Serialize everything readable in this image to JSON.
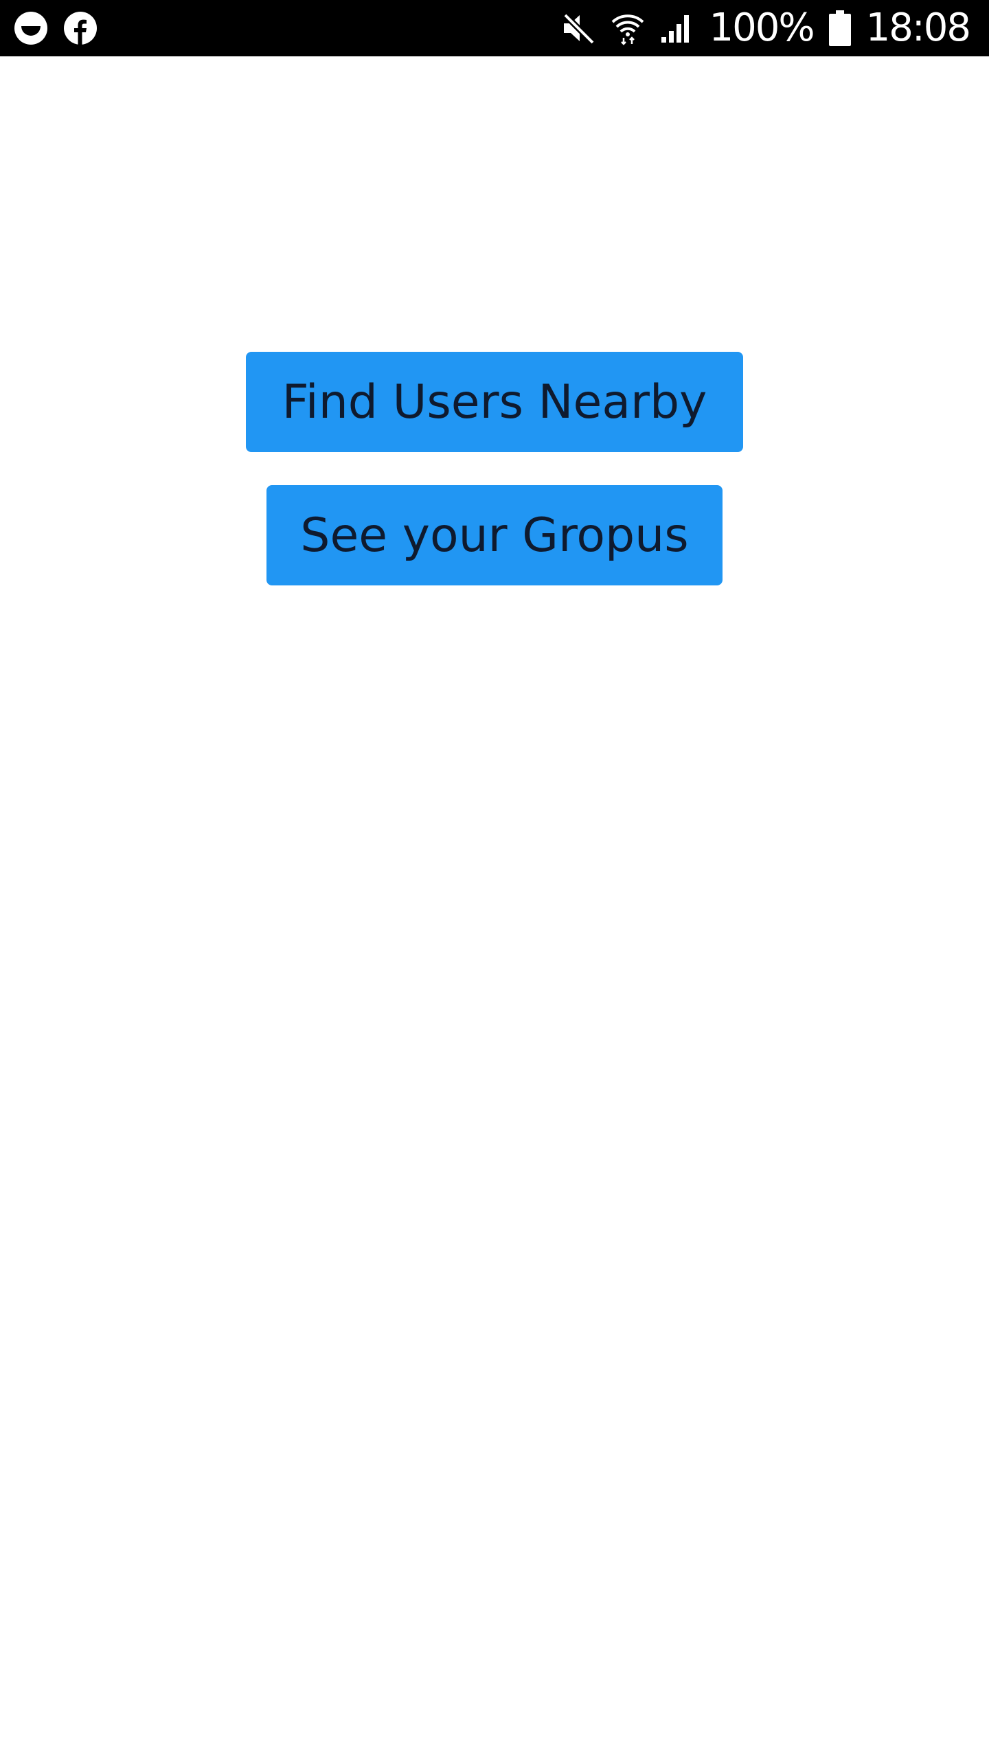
{
  "status_bar": {
    "left_icons": [
      "smiley-notification-icon",
      "facebook-icon"
    ],
    "right_icons": [
      "mute-icon",
      "wifi-icon",
      "cell-signal-icon",
      "battery-icon"
    ],
    "battery_percent": "100%",
    "time": "18:08"
  },
  "main": {
    "find_users_label": "Find Users Nearby",
    "see_groups_label": "See your Gropus"
  },
  "colors": {
    "button_background": "#2196F3",
    "button_text": "#0f1a2e",
    "status_bar_background": "#000000"
  }
}
